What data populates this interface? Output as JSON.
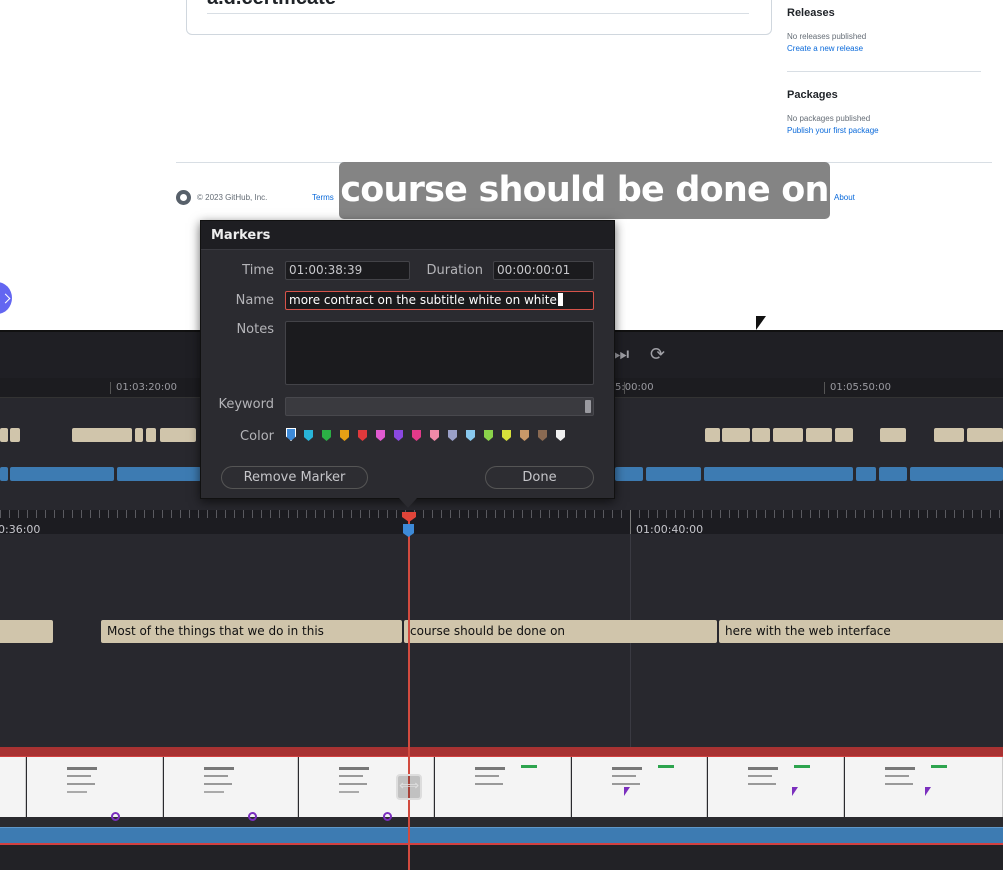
{
  "github": {
    "cert_title": "a.d.certificate",
    "releases_heading": "Releases",
    "releases_status": "No releases published",
    "releases_link": "Create a new release",
    "packages_heading": "Packages",
    "packages_status": "No packages published",
    "packages_link": "Publish your first package",
    "footer_copyright": "© 2023 GitHub, Inc.",
    "footer_terms": "Terms",
    "footer_about": "About"
  },
  "subtitle_overlay": "course should be done on",
  "timeline": {
    "mini_ruler_labels": [
      "01:03:20:00",
      "5:00:00",
      "01:05:50:00"
    ],
    "ruler_labels": [
      "0:36:00",
      "01:00:40:00"
    ],
    "subtitle_clips": [
      {
        "text": ""
      },
      {
        "text": "Most of the things that we do in this"
      },
      {
        "text": "course should be done on"
      },
      {
        "text": "here with the web interface"
      }
    ],
    "trim_icon": "trim-icon",
    "accent_playhead": "#d24b3f",
    "video_bar_color": "#a83232",
    "audio_color": "#3d7bb2",
    "subtitle_clip_color": "#d0c5ab"
  },
  "markers_dialog": {
    "title": "Markers",
    "time_label": "Time",
    "time_value": "01:00:38:39",
    "duration_label": "Duration",
    "duration_value": "00:00:00:01",
    "name_label": "Name",
    "name_value": "more contract on the subtitle white on white",
    "notes_label": "Notes",
    "notes_value": "",
    "keyword_label": "Keyword",
    "color_label": "Color",
    "colors": [
      "#3d8ad8",
      "#28b4d8",
      "#2bb045",
      "#e8a014",
      "#e0393c",
      "#e05ad0",
      "#8a48e0",
      "#e23a8a",
      "#f08aa8",
      "#9aa0c8",
      "#88c8ee",
      "#8ad24a",
      "#d8e03a",
      "#c89868",
      "#8a6a52",
      "#f0f0f0"
    ],
    "selected_color": "#3d8ad8",
    "remove_button": "Remove Marker",
    "done_button": "Done"
  }
}
